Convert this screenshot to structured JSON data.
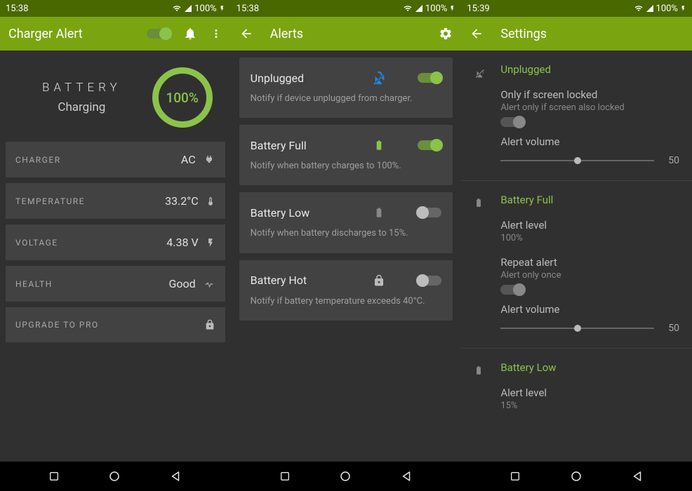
{
  "screen1": {
    "status": {
      "time": "15:38",
      "battery": "100%"
    },
    "app_title": "Charger Alert",
    "battery_label": "BATTERY",
    "battery_status": "Charging",
    "battery_pct": "100%",
    "rows": {
      "charger": {
        "label": "CHARGER",
        "value": "AC"
      },
      "temperature": {
        "label": "TEMPERATURE",
        "value": "33.2°C"
      },
      "voltage": {
        "label": "VOLTAGE",
        "value": "4.38 V"
      },
      "health": {
        "label": "HEALTH",
        "value": "Good"
      },
      "upgrade": {
        "label": "UPGRADE TO PRO"
      }
    }
  },
  "screen2": {
    "status": {
      "time": "15:38",
      "battery": "100%"
    },
    "app_title": "Alerts",
    "cards": {
      "unplugged": {
        "title": "Unplugged",
        "desc": "Notify if device unplugged from charger.",
        "on": true
      },
      "full": {
        "title": "Battery Full",
        "desc": "Notify when battery charges to 100%.",
        "on": true
      },
      "low": {
        "title": "Battery Low",
        "desc": "Notify when battery discharges to 15%.",
        "on": false
      },
      "hot": {
        "title": "Battery Hot",
        "desc": "Notify if battery temperature exceeds 40°C.",
        "on": false
      }
    }
  },
  "screen3": {
    "status": {
      "time": "15:39",
      "battery": "100%"
    },
    "app_title": "Settings",
    "sections": {
      "unplugged": {
        "title": "Unplugged",
        "screen_locked": {
          "label": "Only if screen locked",
          "sub": "Alert only if screen also locked"
        },
        "volume": {
          "label": "Alert volume",
          "value": "50"
        }
      },
      "full": {
        "title": "Battery Full",
        "level": {
          "label": "Alert level",
          "sub": "100%"
        },
        "repeat": {
          "label": "Repeat alert",
          "sub": "Alert only once"
        },
        "volume": {
          "label": "Alert volume",
          "value": "50"
        }
      },
      "low": {
        "title": "Battery Low",
        "level": {
          "label": "Alert level",
          "sub": "15%"
        }
      }
    }
  }
}
